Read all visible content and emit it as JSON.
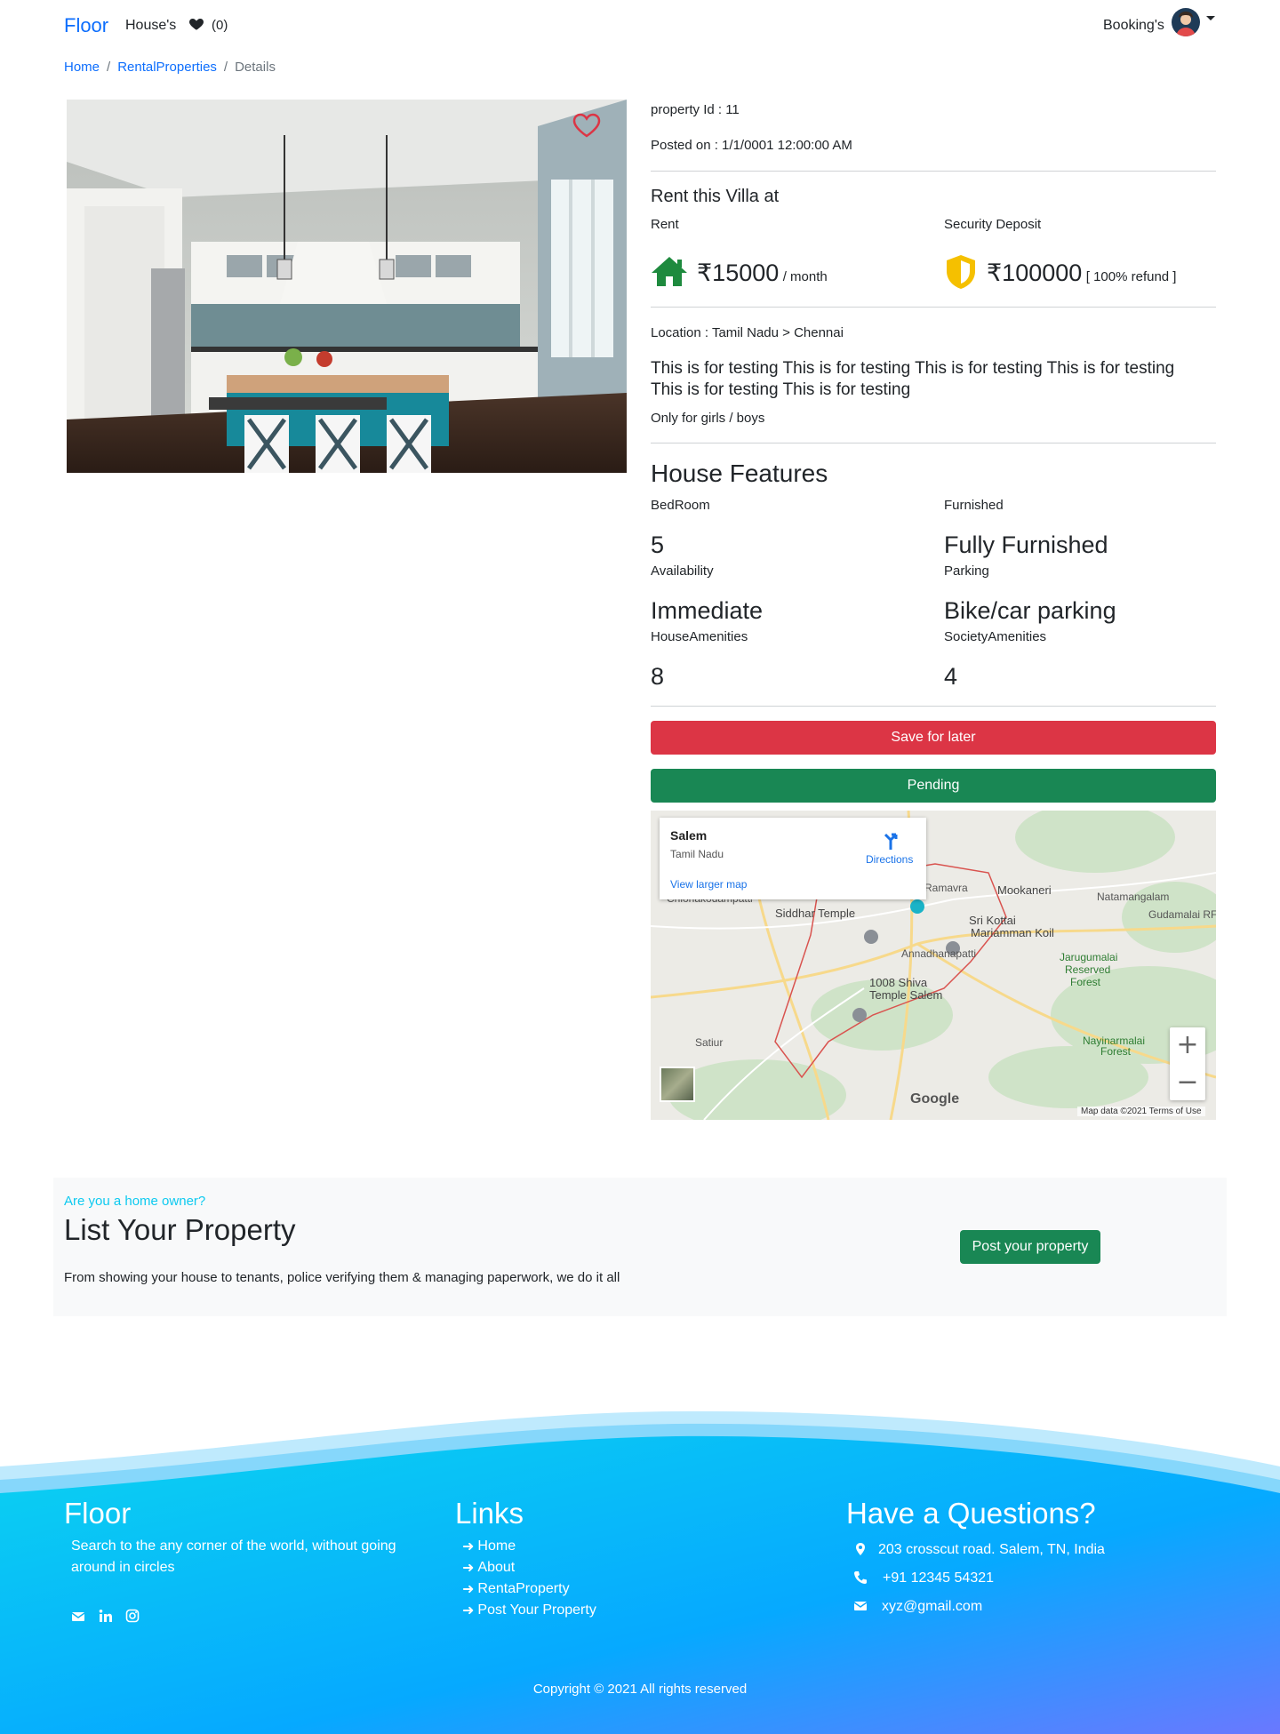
{
  "nav": {
    "brand": "Floor",
    "houses": "House's",
    "wishlist_count": "(0)",
    "bookings": "Booking's"
  },
  "breadcrumb": {
    "home": "Home",
    "sep": "/",
    "rental": "RentalProperties",
    "current": "Details"
  },
  "property": {
    "id_text": "property Id : 11",
    "posted_text": "Posted on : 1/1/0001 12:00:00 AM",
    "rent_heading": "Rent this Villa at",
    "rent_label": "Rent",
    "deposit_label": "Security Deposit",
    "rent_value": "₹15000",
    "rent_unit": "/ month",
    "deposit_value": "₹100000",
    "deposit_note": "[ 100% refund ]",
    "location": "Location : Tamil Nadu > Chennai",
    "description": "This is for testing This is for testing This is for testing This is for testing This is for testing This is for testing",
    "restriction": "Only for girls / boys"
  },
  "features": {
    "heading": "House Features",
    "bedroom_label": "BedRoom",
    "bedroom_value": "5",
    "furnished_label": "Furnished",
    "furnished_value": "Fully Furnished",
    "availability_label": "Availability",
    "availability_value": "Immediate",
    "parking_label": "Parking",
    "parking_value": "Bike/car parking",
    "house_amenities_label": "HouseAmenities",
    "house_amenities_value": "8",
    "society_amenities_label": "SocietyAmenities",
    "society_amenities_value": "4"
  },
  "actions": {
    "save_label": "Save for later",
    "status_label": "Pending"
  },
  "map": {
    "place_title": "Salem",
    "place_sub": "Tamil Nadu",
    "larger_map": "View larger map",
    "directions": "Directions",
    "zoom_in": "+",
    "zoom_out": "−",
    "labels": {
      "chionakodampatti": "Chionakodampatti",
      "siddhar": "Siddhar Temple",
      "ramavra": "Ramavra",
      "mookaneri": "Mookaneri",
      "natamangalam": "Natamangalam",
      "gudamalai": "Gudamalai RF",
      "srikottai": "Sri Kottai",
      "mariamman": "Mariamman Koil",
      "annadhanapatti": "Annadhanapatti",
      "jarugumalai": "Jarugumalai",
      "reserved": "Reserved",
      "forest": "Forest",
      "shiva": "1008 Shiva",
      "temple_salem": "Temple Salem",
      "nayinarmalai": "Nayinarmalai",
      "forest2": "Forest",
      "satiur": "Satiur"
    },
    "google": "Google",
    "attribution": "Map data ©2021   Terms of Use"
  },
  "promo": {
    "tag": "Are you a home owner?",
    "title": "List Your Property",
    "text": "From showing your house to tenants, police verifying them & managing paperwork, we do it all",
    "button": "Post your property"
  },
  "footer": {
    "brand": "Floor",
    "tagline": "Search to the any corner of the world, without going around in circles",
    "links_title": "Links",
    "links": [
      "Home",
      "About",
      "RentaProperty",
      "Post Your Property"
    ],
    "contact_title": "Have a Questions?",
    "address": "203 crosscut road. Salem, TN, India",
    "phone": "+91 12345 54321",
    "email": "xyz@gmail.com",
    "copyright": "Copyright © 2021 All rights reserved"
  },
  "colors": {
    "primary": "#0d6efd",
    "danger": "#dc3545",
    "success": "#198754",
    "info": "#0dcaf0",
    "house_icon": "#1e8a3e",
    "shield_icon": "#f5c000",
    "footer_gradient_start": "#0bd3f0",
    "footer_gradient_end": "#6a78ff"
  }
}
